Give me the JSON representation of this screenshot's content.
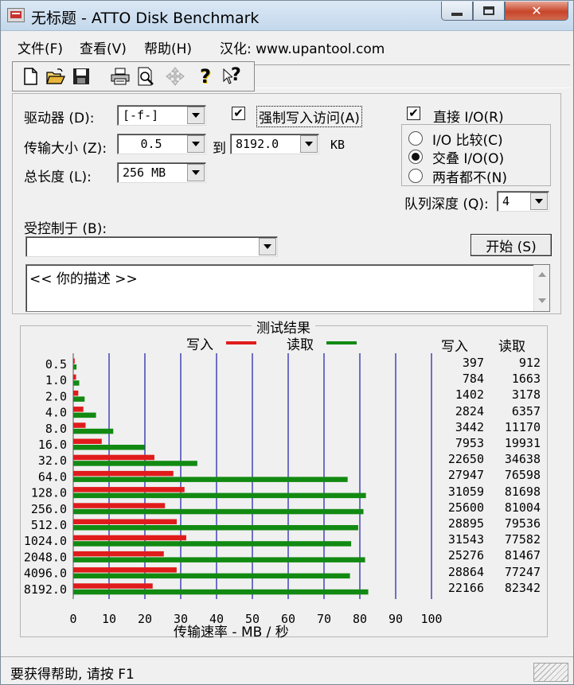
{
  "window": {
    "title": "无标题 - ATTO Disk Benchmark",
    "close_glyph": "✕"
  },
  "menu": {
    "file": "文件(F)",
    "view": "查看(V)",
    "help": "帮助(H)",
    "credit": "汉化: www.upantool.com"
  },
  "toolbar": {
    "help_glyph": "?",
    "context_help_glyph": "?"
  },
  "settings": {
    "drive_label": "驱动器 (D):",
    "drive_value": "[-f-]",
    "force_write_label": "强制写入访问(A)",
    "force_write_checked": true,
    "direct_io_label": "直接 I/O(R)",
    "direct_io_checked": true,
    "transfer_size_label": "传输大小 (Z):",
    "transfer_from": "0.5",
    "to_label": "到",
    "transfer_to": "8192.0",
    "kb_label": "KB",
    "total_length_label": "总长度 (L):",
    "total_length_value": "256 MB",
    "io_compare_label": "I/O 比较(C)",
    "overlap_io_label": "交叠 I/O(O)",
    "neither_label": "两者都不(N)",
    "selected_mode": "overlap",
    "queue_depth_label": "队列深度 (Q):",
    "queue_depth_value": "4",
    "controlled_by_label": "受控制于 (B):",
    "controlled_by_value": "",
    "start_label": "开始 (S)",
    "description": "<<  你的描述   >>",
    "check_glyph": "✔"
  },
  "results": {
    "title": "测试结果",
    "write_legend": "写入",
    "read_legend": "读取",
    "write_header": "写入",
    "read_header": "读取",
    "xlabel": "传输速率 - MB / 秒"
  },
  "colors": {
    "write": "#e01b1b",
    "read": "#128a12",
    "grid": "#2a2ab0"
  },
  "chart_data": {
    "type": "bar",
    "orientation": "horizontal",
    "categories": [
      "0.5",
      "1.0",
      "2.0",
      "4.0",
      "8.0",
      "16.0",
      "32.0",
      "64.0",
      "128.0",
      "256.0",
      "512.0",
      "1024.0",
      "2048.0",
      "4096.0",
      "8192.0"
    ],
    "series": [
      {
        "name": "写入",
        "values": [
          397,
          784,
          1402,
          2824,
          3442,
          7953,
          22650,
          27947,
          31059,
          25600,
          28895,
          31543,
          25276,
          28864,
          22166
        ]
      },
      {
        "name": "读取",
        "values": [
          912,
          1663,
          3178,
          6357,
          11170,
          19931,
          34638,
          76598,
          81698,
          81004,
          79536,
          77582,
          81467,
          77247,
          82342
        ]
      }
    ],
    "xlabel": "传输速率 - MB / 秒",
    "xticks": [
      0,
      10,
      20,
      30,
      40,
      50,
      60,
      70,
      80,
      90,
      100
    ],
    "xlim": [
      0,
      100
    ],
    "value_scale_note_units": "KB/s",
    "grid": true,
    "legend": "top"
  },
  "status_bar": {
    "text": "要获得帮助, 请按 F1"
  }
}
